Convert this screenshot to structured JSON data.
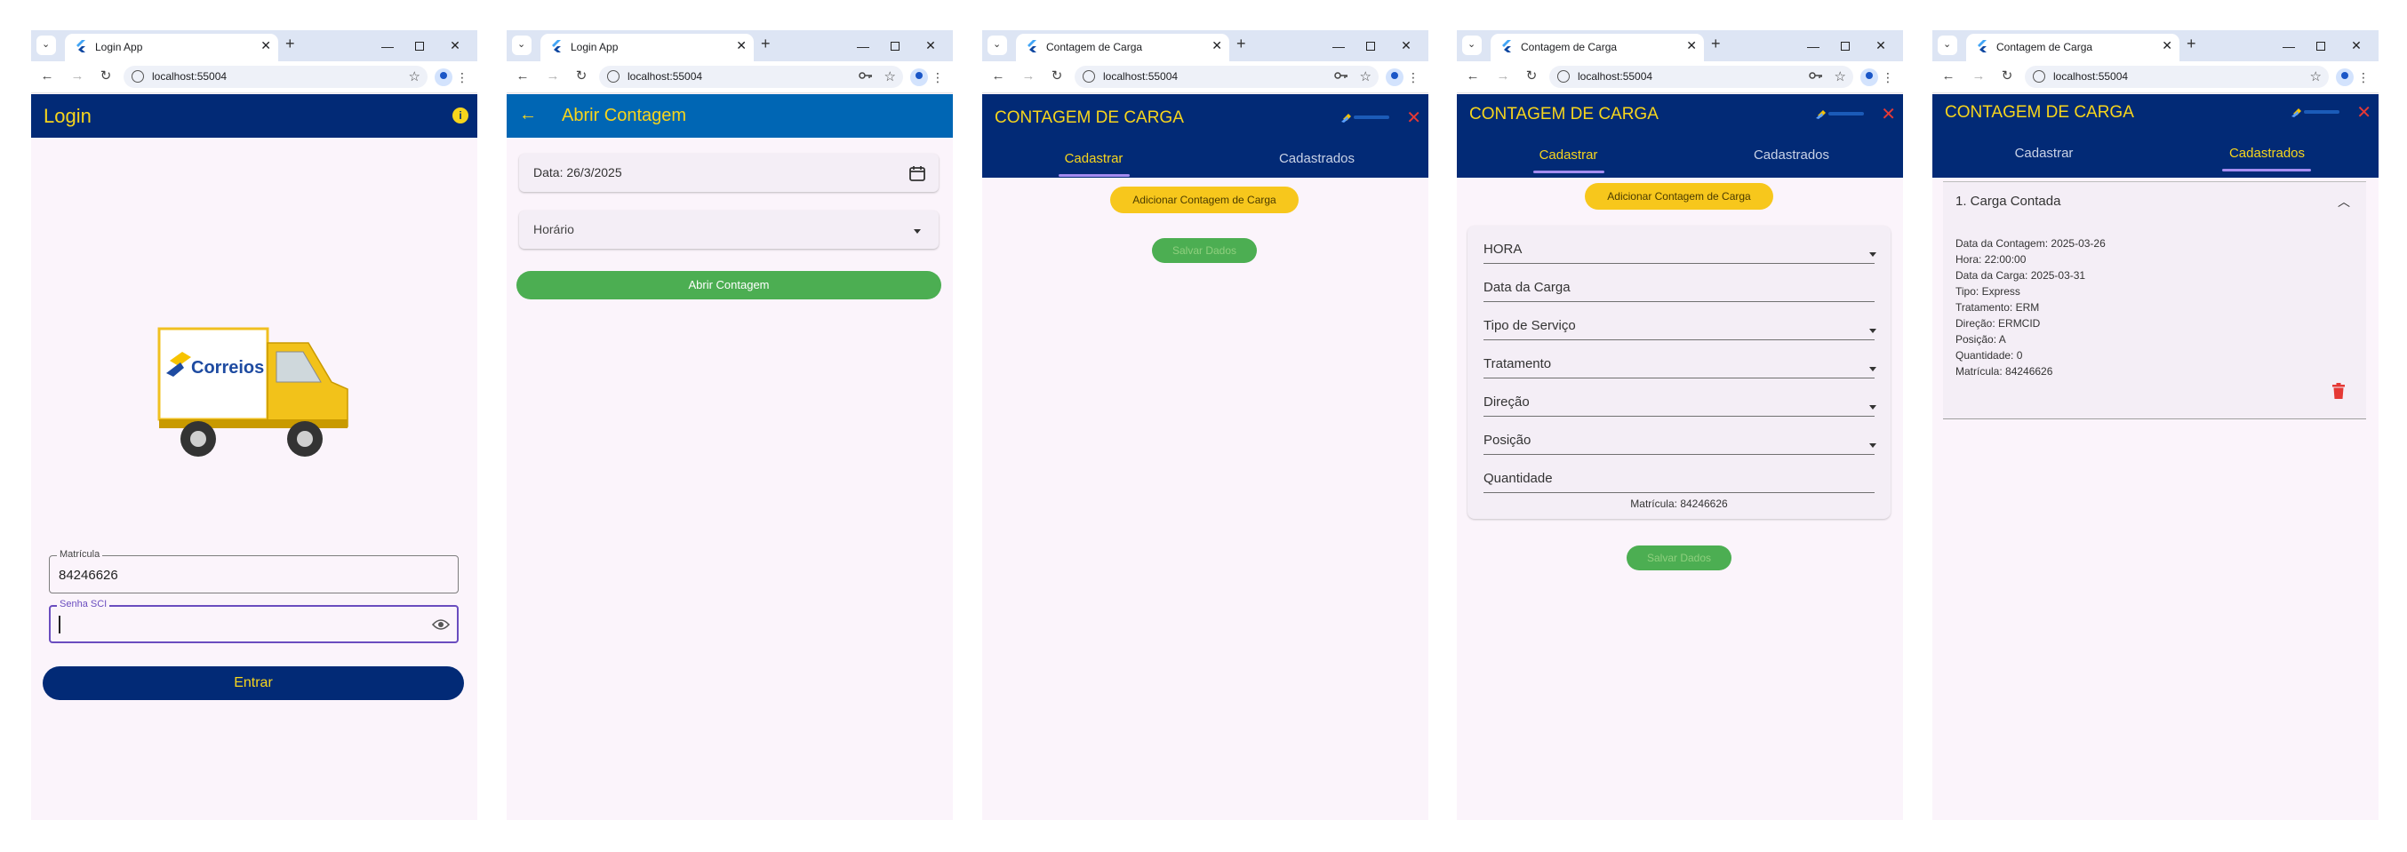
{
  "windows": [
    {
      "tab_title": "Login App",
      "url": "localhost:55004"
    },
    {
      "tab_title": "Login App",
      "url": "localhost:55004"
    },
    {
      "tab_title": "Contagem de Carga",
      "url": "localhost:55004"
    },
    {
      "tab_title": "Contagem de Carga",
      "url": "localhost:55004"
    },
    {
      "tab_title": "Contagem de Carga",
      "url": "localhost:55004"
    }
  ],
  "login": {
    "title": "Login",
    "logo_text": "Correios",
    "matricula_label": "Matrícula",
    "matricula_value": "84246626",
    "senha_label": "Senha SCI",
    "enter_button": "Entrar"
  },
  "abrir": {
    "title": "Abrir Contagem",
    "date_value": "Data: 26/3/2025",
    "horario_placeholder": "Horário",
    "open_button": "Abrir Contagem"
  },
  "contagem": {
    "title": "CONTAGEM DE CARGA",
    "tab_cadastrar": "Cadastrar",
    "tab_cadastrados": "Cadastrados",
    "add_button": "Adicionar Contagem de Carga",
    "save_button": "Salvar Dados"
  },
  "form": {
    "fields": [
      "HORA",
      "Data da Carga",
      "Tipo de Serviço",
      "Tratamento",
      "Direção",
      "Posição",
      "Quantidade"
    ],
    "matricula": "Matrícula: 84246626"
  },
  "cadastrados": {
    "item_title": "1. Carga Contada",
    "details": [
      "Data da Contagem: 2025-03-26",
      "Hora: 22:00:00",
      "Data da Carga: 2025-03-31",
      "Tipo: Express",
      "Tratamento: ERM",
      "Direção: ERMCID",
      "Posição: A",
      "Quantidade: 0",
      "Matrícula: 84246626"
    ]
  },
  "colors": {
    "navy": "#022a76",
    "yellow": "#f7d51c",
    "blue_appbar": "#0066b4",
    "green": "#4cae52",
    "red": "#e53935"
  }
}
